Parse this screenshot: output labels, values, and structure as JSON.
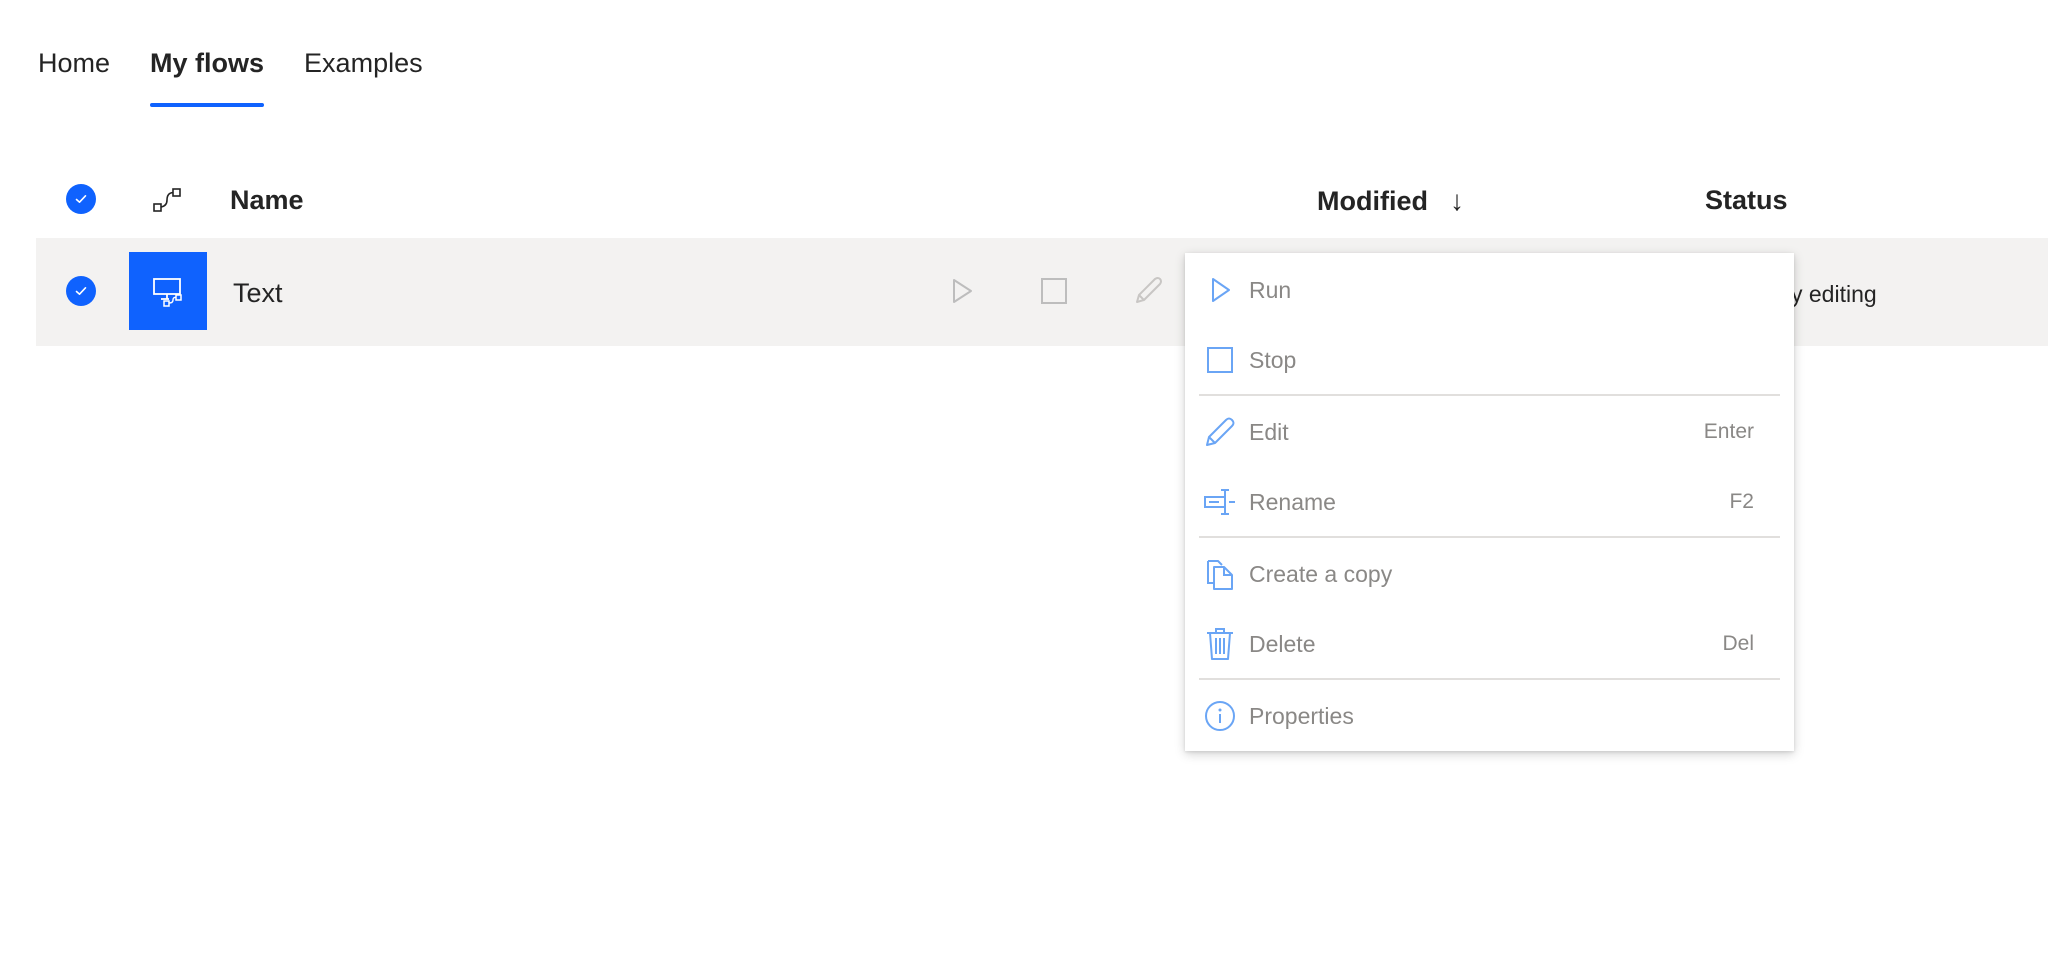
{
  "tabs": [
    {
      "label": "Home",
      "active": false
    },
    {
      "label": "My flows",
      "active": true
    },
    {
      "label": "Examples",
      "active": false
    }
  ],
  "table": {
    "headers": {
      "name": "Name",
      "modified": "Modified",
      "sort_indicator": "↓",
      "status": "Status"
    },
    "rows": [
      {
        "name": "Text",
        "status_partial": "y editing",
        "selected": true
      }
    ]
  },
  "context_menu": {
    "items": [
      {
        "label": "Run",
        "shortcut": "",
        "icon": "play-icon"
      },
      {
        "label": "Stop",
        "shortcut": "",
        "icon": "stop-icon"
      },
      {
        "label": "Edit",
        "shortcut": "Enter",
        "icon": "pencil-icon"
      },
      {
        "label": "Rename",
        "shortcut": "F2",
        "icon": "rename-icon"
      },
      {
        "label": "Create a copy",
        "shortcut": "",
        "icon": "copy-icon"
      },
      {
        "label": "Delete",
        "shortcut": "Del",
        "icon": "trash-icon"
      },
      {
        "label": "Properties",
        "shortcut": "",
        "icon": "info-icon"
      }
    ]
  },
  "colors": {
    "accent": "#0f62fe",
    "row_bg": "#f3f2f1",
    "menu_text_disabled": "#8a8886",
    "menu_icon": "#6aa5f5"
  }
}
